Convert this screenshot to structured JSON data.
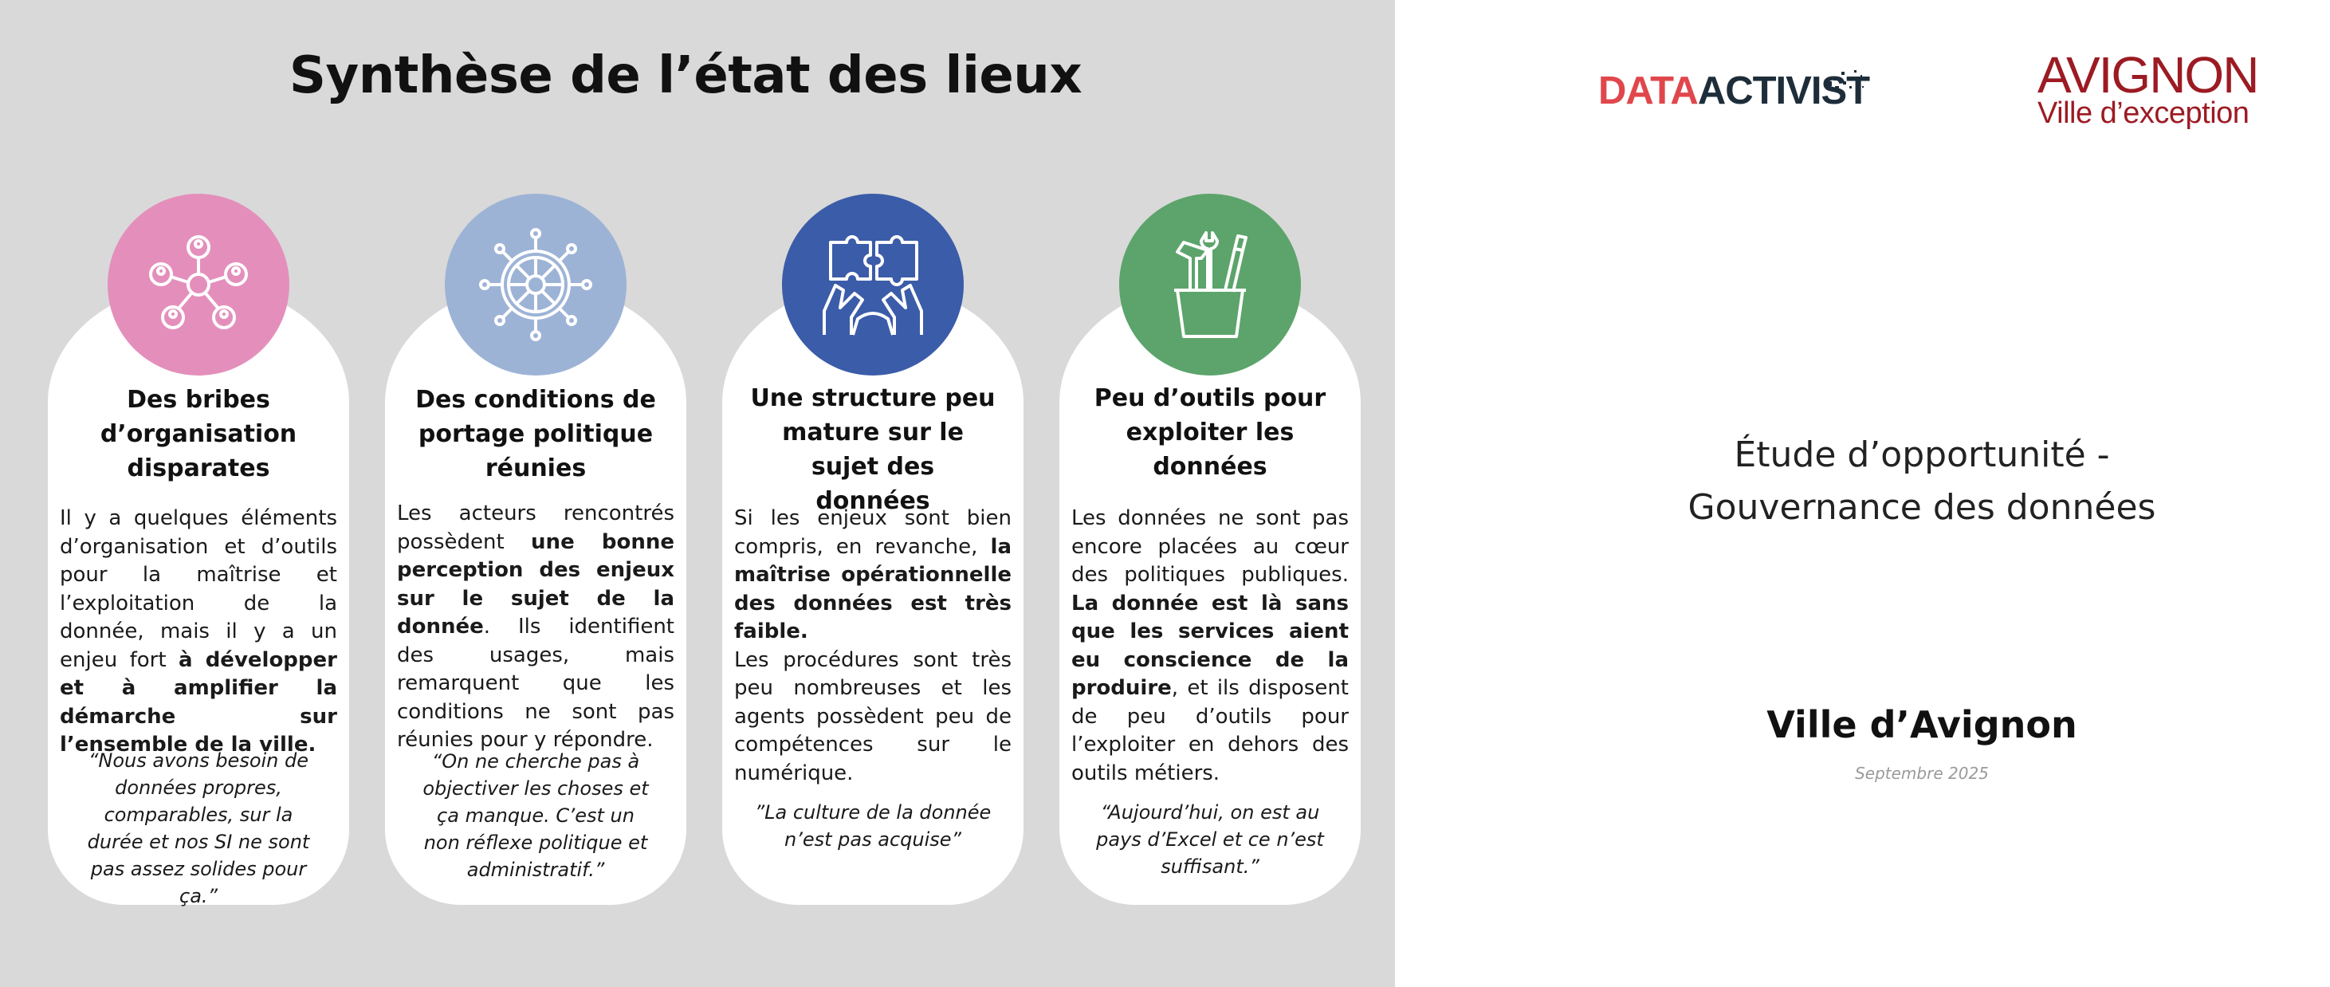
{
  "slide": {
    "title": "Synthèse de l’état des lieux"
  },
  "colors": {
    "left_background": "#d9d9d9",
    "card_background": "#ffffff",
    "card1_circle": "#e48fbb",
    "card2_circle": "#9db3d6",
    "card3_circle": "#3b5ca8",
    "card4_circle": "#5ca46b",
    "datactivist_red": "#e0474c",
    "datactivist_dark": "#1e2d3a",
    "avignon_red": "#9c1b23"
  },
  "cards": [
    {
      "icon": "network-people-icon",
      "title": "Des bribes d’organisation disparates",
      "body_parts": [
        "Il y a quelques éléments d’organisation et d’outils pour la maîtrise et l’exploitation de la donnée, mais il y a un enjeu fort ",
        "à développer et à amplifier la démarche sur l’ensemble de la ville."
      ],
      "quote": "“Nous avons besoin de données propres, comparables, sur la durée et nos SI ne sont pas assez solides pour ça.”"
    },
    {
      "icon": "ship-wheel-icon",
      "title": "Des conditions de portage politique réunies",
      "body_parts": [
        "Les acteurs rencontrés possèdent ",
        "une bonne perception des enjeux sur le sujet de la donnée",
        ". Ils identifient des usages, mais remarquent que les conditions ne sont pas réunies pour y répondre."
      ],
      "quote": "“On ne cherche pas à objectiver les choses et ça manque. C’est un non réflexe politique et administratif.”"
    },
    {
      "icon": "puzzle-hands-icon",
      "title": "Une structure peu mature sur le sujet des données",
      "body_parts": [
        "Si les enjeux sont bien compris, en revanche, ",
        "la maîtrise opérationnelle des données est très faible.",
        "Les procédures sont très peu nombreuses et les agents possèdent peu de compétences sur le numérique."
      ],
      "quote": "”La culture de la donnée n’est pas acquise”"
    },
    {
      "icon": "toolbox-icon",
      "title": "Peu d’outils pour exploiter les données",
      "body_parts": [
        "Les données ne sont pas encore placées au cœur des politiques publiques. ",
        "La donnée est là sans que les services aient eu conscience de la produire",
        ", et ils disposent de peu d’outils pour l’exploiter en dehors des outils métiers."
      ],
      "quote": "“Aujourd’hui, on est au pays d’Excel et ce n’est suffisant.”"
    }
  ],
  "logos": {
    "datactivist_part1": "DATA",
    "datactivist_part2": "ACTIVIST",
    "avignon_name": "AVIGNON",
    "avignon_tagline": "Ville d’exception"
  },
  "cover": {
    "study_title_line1": "Étude d’opportunité -",
    "study_title_line2": "Gouvernance des données",
    "city": "Ville d’Avignon",
    "date": "Septembre 2025"
  }
}
